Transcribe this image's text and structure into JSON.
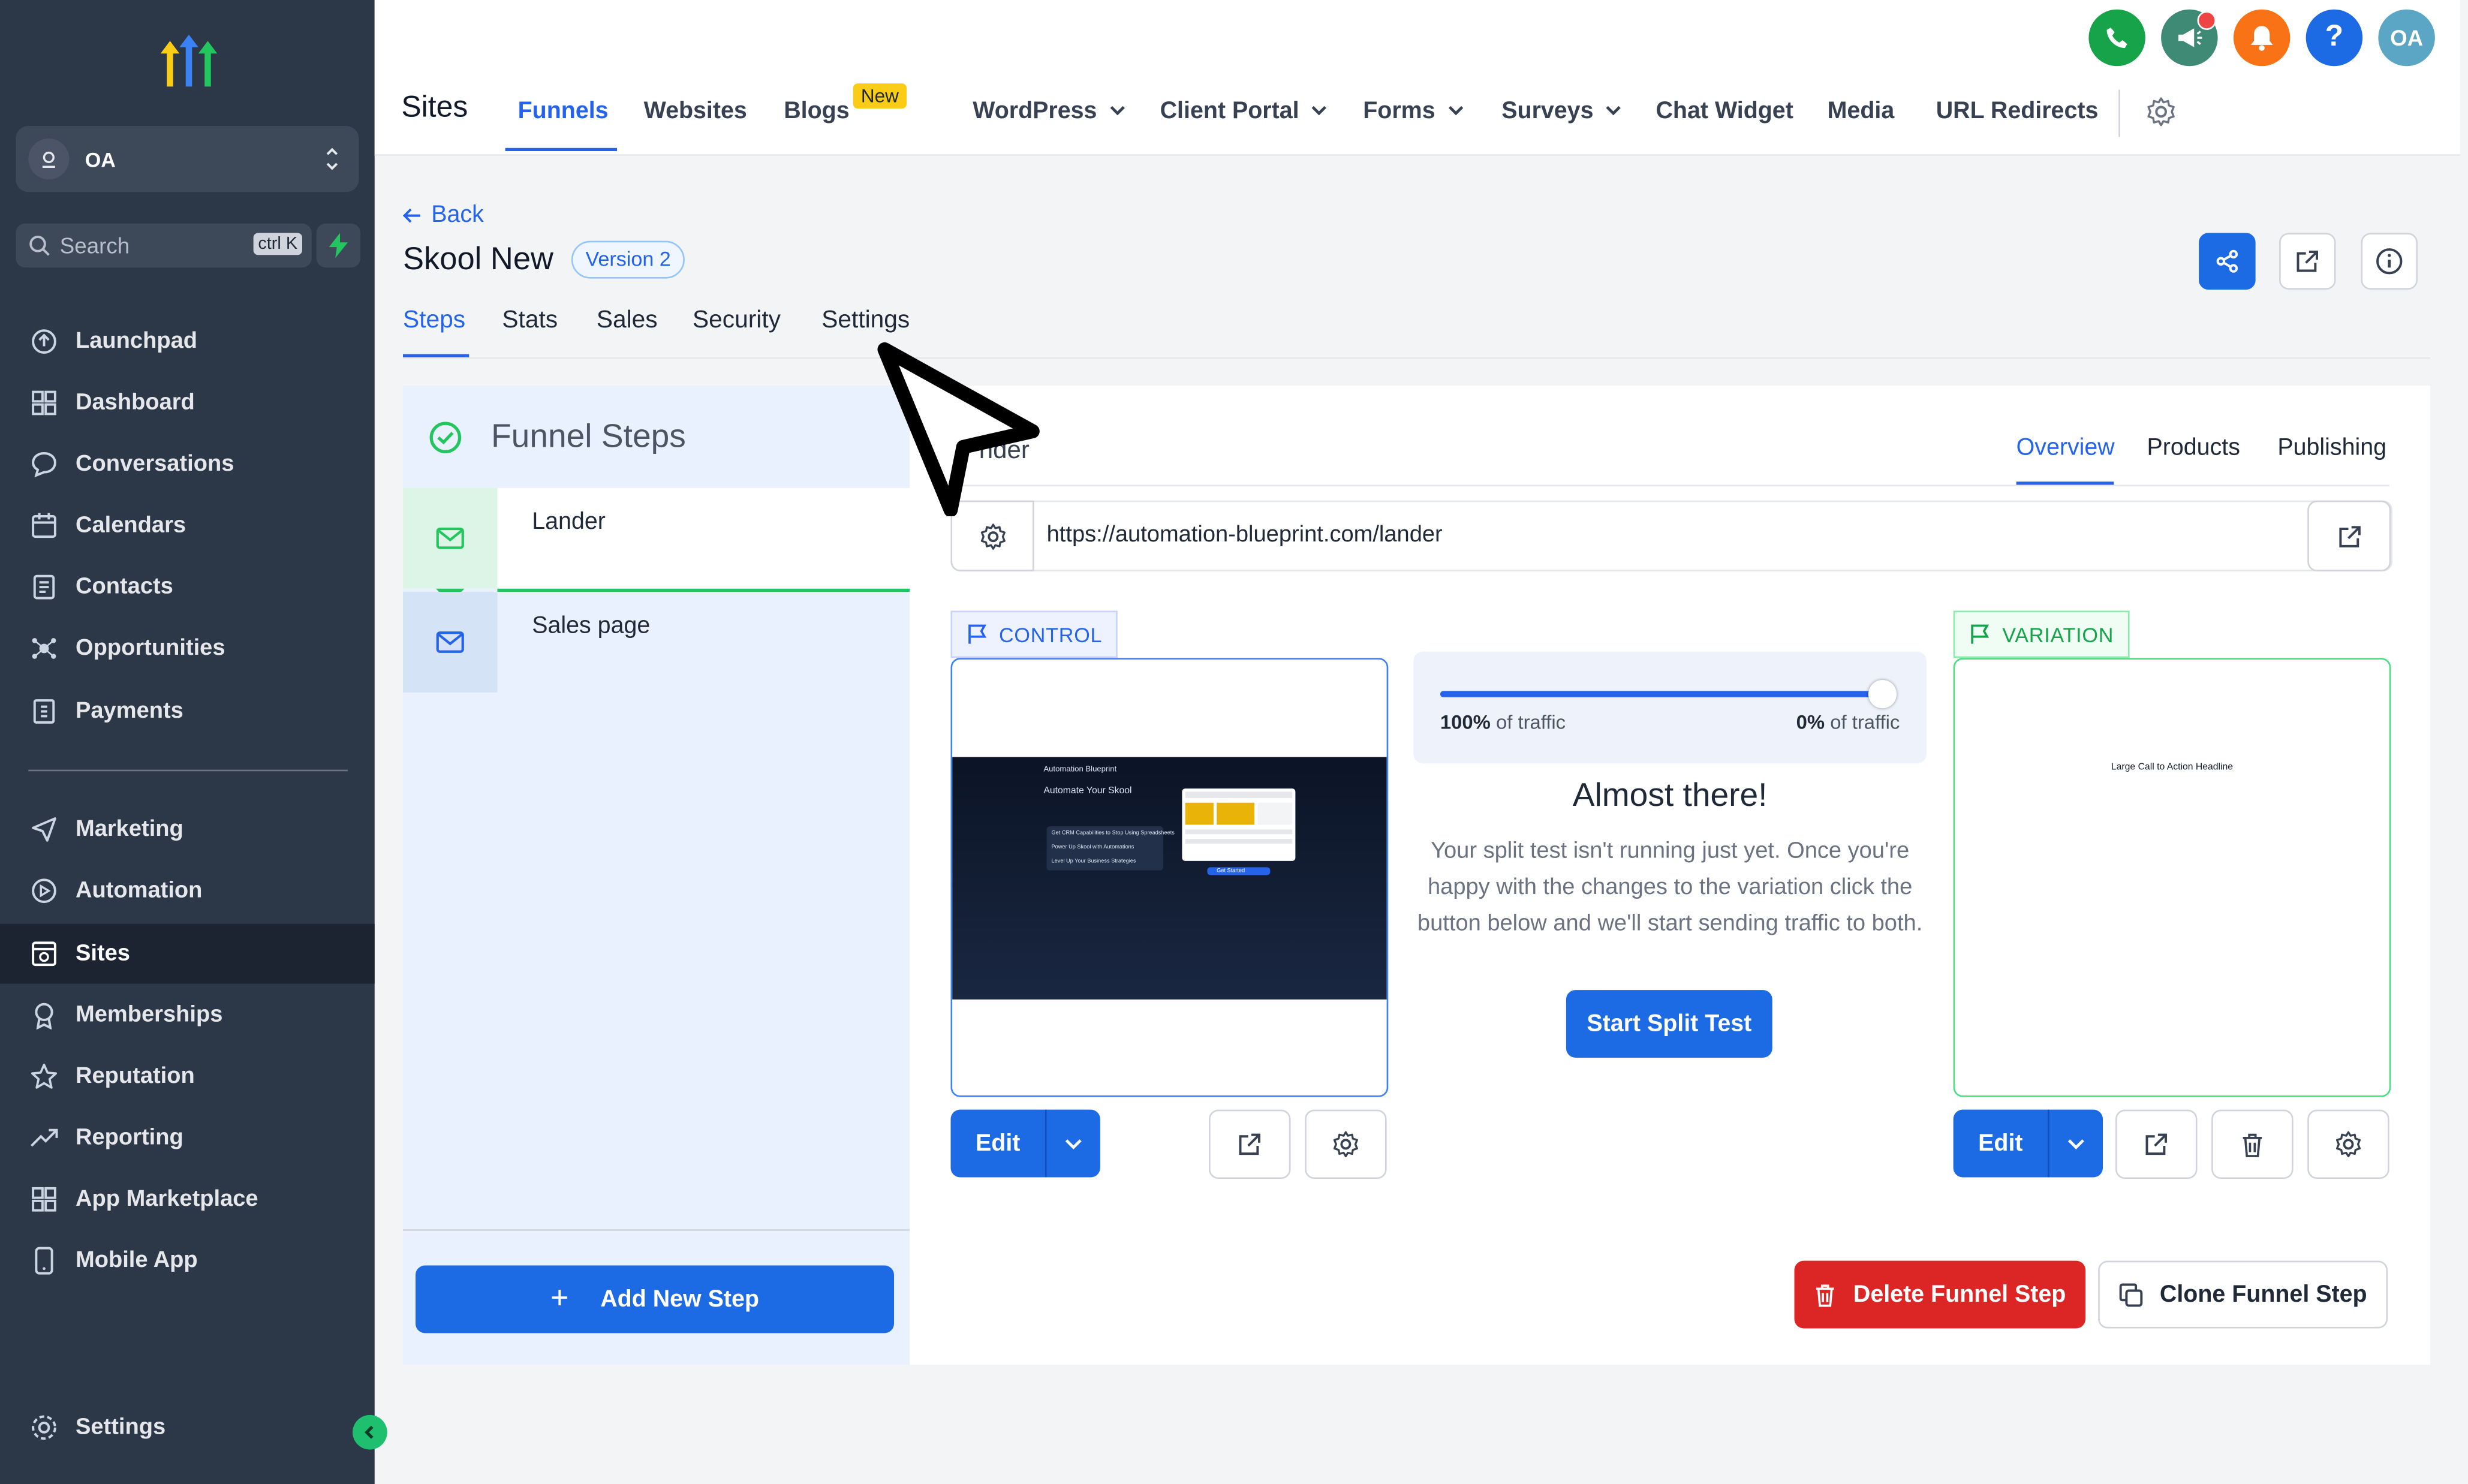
{
  "sidebar": {
    "account_name": "OA",
    "search_placeholder": "Search",
    "search_shortcut": "ctrl K",
    "items": [
      {
        "label": "Launchpad",
        "icon": "launchpad-icon"
      },
      {
        "label": "Dashboard",
        "icon": "dashboard-icon"
      },
      {
        "label": "Conversations",
        "icon": "chat-icon"
      },
      {
        "label": "Calendars",
        "icon": "calendar-icon"
      },
      {
        "label": "Contacts",
        "icon": "contacts-icon"
      },
      {
        "label": "Opportunities",
        "icon": "opportunities-icon"
      },
      {
        "label": "Payments",
        "icon": "payments-icon"
      }
    ],
    "items2": [
      {
        "label": "Marketing",
        "icon": "send-icon"
      },
      {
        "label": "Automation",
        "icon": "automation-icon"
      },
      {
        "label": "Sites",
        "icon": "sites-icon",
        "active": true
      },
      {
        "label": "Memberships",
        "icon": "badge-icon"
      },
      {
        "label": "Reputation",
        "icon": "star-icon"
      },
      {
        "label": "Reporting",
        "icon": "trend-icon"
      },
      {
        "label": "App Marketplace",
        "icon": "grid-icon"
      },
      {
        "label": "Mobile App",
        "icon": "phone-icon"
      }
    ],
    "settings_label": "Settings"
  },
  "topbar": {
    "title": "Sites",
    "links": [
      "Funnels",
      "Websites",
      "Blogs",
      "WordPress",
      "Client Portal",
      "Forms",
      "Surveys",
      "Chat Widget",
      "Media",
      "URL Redirects"
    ],
    "new_badge": "New",
    "avatar_initials": "OA",
    "help_label": "?",
    "colors": {
      "phone": "#16a34a",
      "announce": "#3f8a74",
      "bell": "#f97316",
      "help": "#1d6ae5",
      "avatar": "#5aa6c4"
    }
  },
  "funnel": {
    "back_label": "Back",
    "title": "Skool New",
    "version": "Version 2",
    "subtabs": [
      "Steps",
      "Stats",
      "Sales",
      "Security",
      "Settings"
    ]
  },
  "steps": {
    "header": "Funnel Steps",
    "items": [
      "Lander",
      "Sales page"
    ],
    "add_label": "Add New Step"
  },
  "main": {
    "step_name_visible": "nder",
    "tabs": [
      "Overview",
      "Products",
      "Publishing"
    ],
    "url": "https://automation-blueprint.com/lander",
    "control_label": "CONTROL",
    "variation_label": "VARIATION",
    "control_preview": {
      "brand": "Automation Blueprint",
      "headline": "Automate Your Skool",
      "bullets": [
        "Get CRM Capabilities to Stop Using Spreadsheets",
        "Power Up Skool with Automations",
        "Level Up Your Business Strategies"
      ],
      "cta": "Get Started"
    },
    "variation_preview_headline": "Large Call to Action Headline",
    "traffic_left_pct": "100%",
    "traffic_left_text": "of traffic",
    "traffic_right_pct": "0%",
    "traffic_right_text": "of traffic",
    "control_traffic_fraction": 1.0,
    "almost_title": "Almost there!",
    "split_description": "Your split test isn't running just yet. Once you're happy with the changes to the variation click the button below and we'll start sending traffic to both.",
    "start_split_label": "Start Split Test",
    "edit_label": "Edit",
    "delete_label": "Delete Funnel Step",
    "clone_label": "Clone Funnel Step"
  }
}
